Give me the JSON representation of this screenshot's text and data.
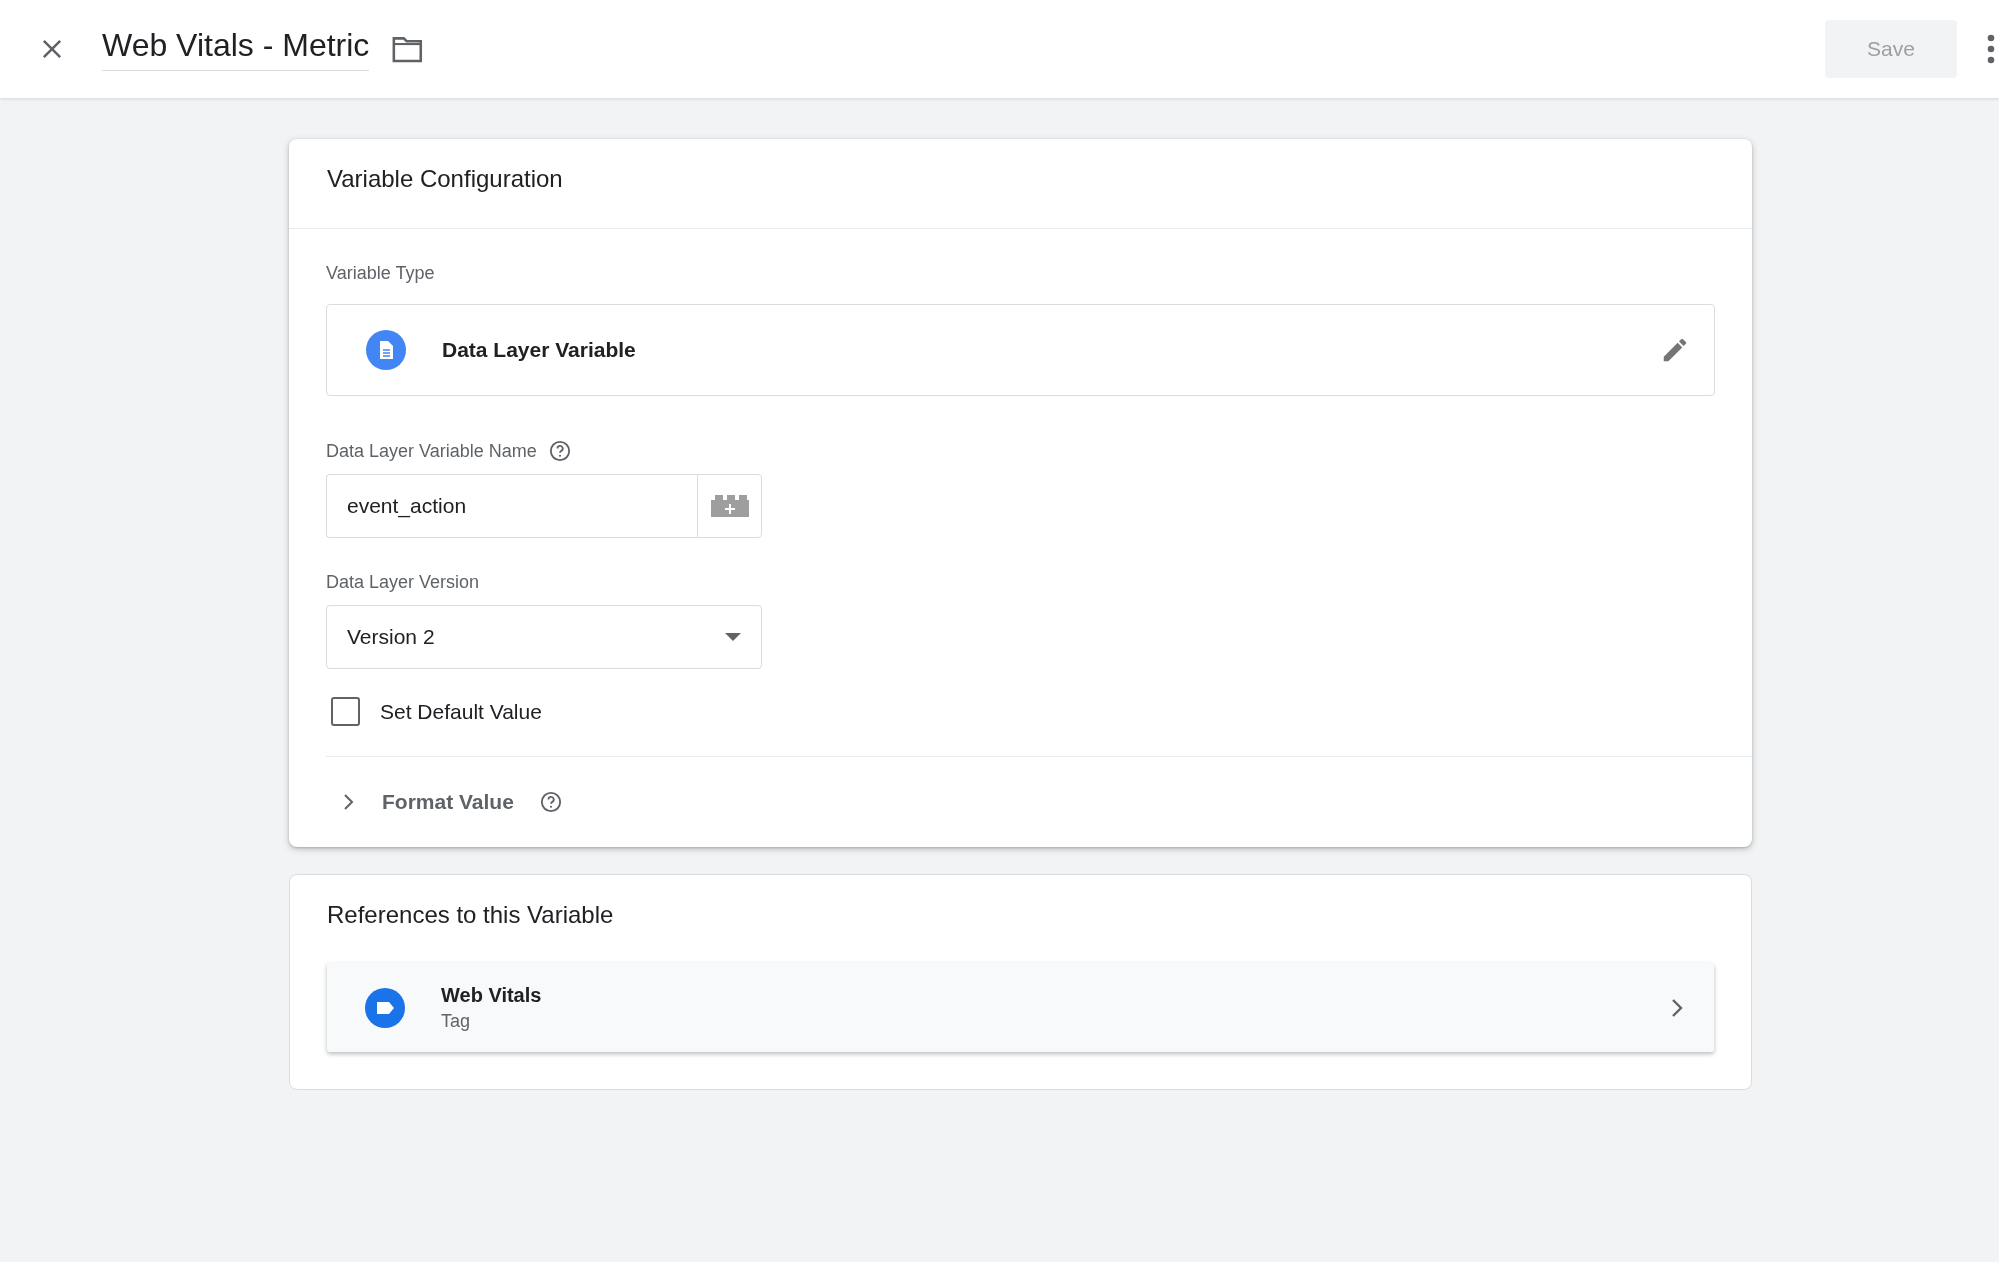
{
  "header": {
    "title": "Web Vitals - Metric",
    "save_button": {
      "label": "Save",
      "disabled": true
    }
  },
  "configuration": {
    "title": "Variable Configuration",
    "variable_type": {
      "label": "Variable Type",
      "value": "Data Layer Variable"
    },
    "name_field": {
      "label": "Data Layer Variable Name",
      "value": "event_action"
    },
    "version_field": {
      "label": "Data Layer Version",
      "value": "Version 2"
    },
    "default_value": {
      "label": "Set Default Value",
      "checked": false
    },
    "format_value": {
      "label": "Format Value",
      "expanded": false
    }
  },
  "references": {
    "title": "References to this Variable",
    "items": [
      {
        "name": "Web Vitals",
        "type": "Tag"
      }
    ]
  }
}
